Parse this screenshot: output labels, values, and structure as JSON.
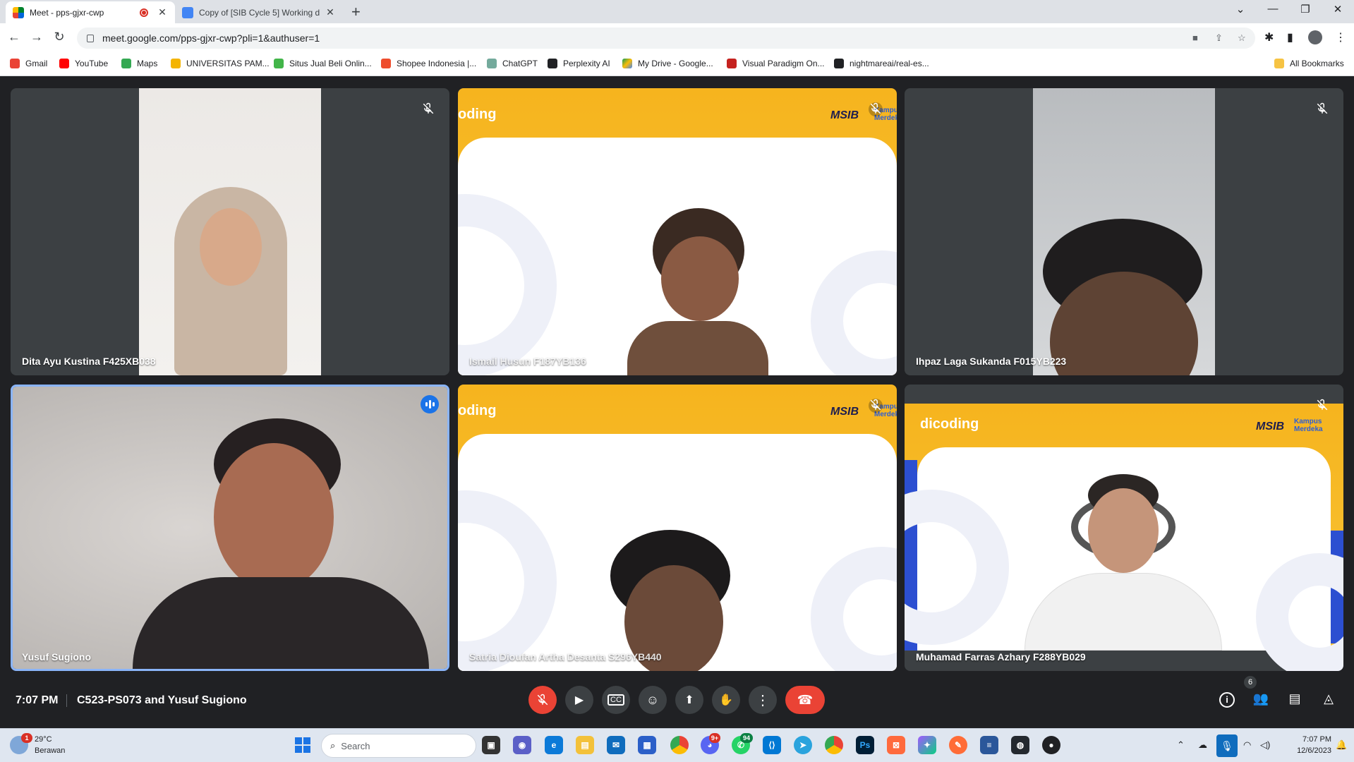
{
  "browser": {
    "tabs": [
      {
        "label": "Meet - pps-gjxr-cwp",
        "active": true
      },
      {
        "label": "Copy of [SIB Cycle 5] Working d",
        "active": false
      }
    ],
    "url": "meet.google.com/pps-gjxr-cwp?pli=1&authuser=1",
    "bookmarks": [
      "Gmail",
      "YouTube",
      "Maps",
      "UNIVERSITAS PAM...",
      "Situs Jual Beli Onlin...",
      "Shopee Indonesia |...",
      "ChatGPT",
      "Perplexity AI",
      "My Drive - Google...",
      "Visual Paradigm On...",
      "nightmareai/real-es..."
    ],
    "all_bookmarks": "All Bookmarks"
  },
  "meet": {
    "participants": [
      {
        "name": "Dita Ayu Kustina F425XB038",
        "muted": true
      },
      {
        "name": "Ismail Husun F187YB136",
        "muted": true
      },
      {
        "name": "Ihpaz Laga Sukanda F015YB223",
        "muted": true
      },
      {
        "name": "Yusuf Sugiono",
        "muted": false,
        "speaking": true
      },
      {
        "name": "Satria Dioufan Artha Desanta S296YB440",
        "muted": true
      },
      {
        "name": "Muhamad Farras Azhary F288YB029",
        "muted": true
      }
    ],
    "virtual_bg": {
      "brand": "dicoding",
      "brand_partial": "oding",
      "program": "MSIB",
      "kampus": "Kampus",
      "merdeka": "Merdeka"
    },
    "time": "7:07 PM",
    "meeting_title": "C523-PS073 and Yusuf Sugiono",
    "people_count": "6"
  },
  "taskbar": {
    "weather_temp": "29°C",
    "weather_desc": "Berawan",
    "weather_badge": "1",
    "search_placeholder": "Search",
    "discord_badge": "9+",
    "whatsapp_badge": "94",
    "time": "7:07 PM",
    "date": "12/6/2023"
  },
  "colors": {
    "accent": "#1a73e8",
    "danger": "#ea4335",
    "meet_bg": "#202124",
    "tile_bg": "#3c4043",
    "banner": "#f6b41e"
  }
}
